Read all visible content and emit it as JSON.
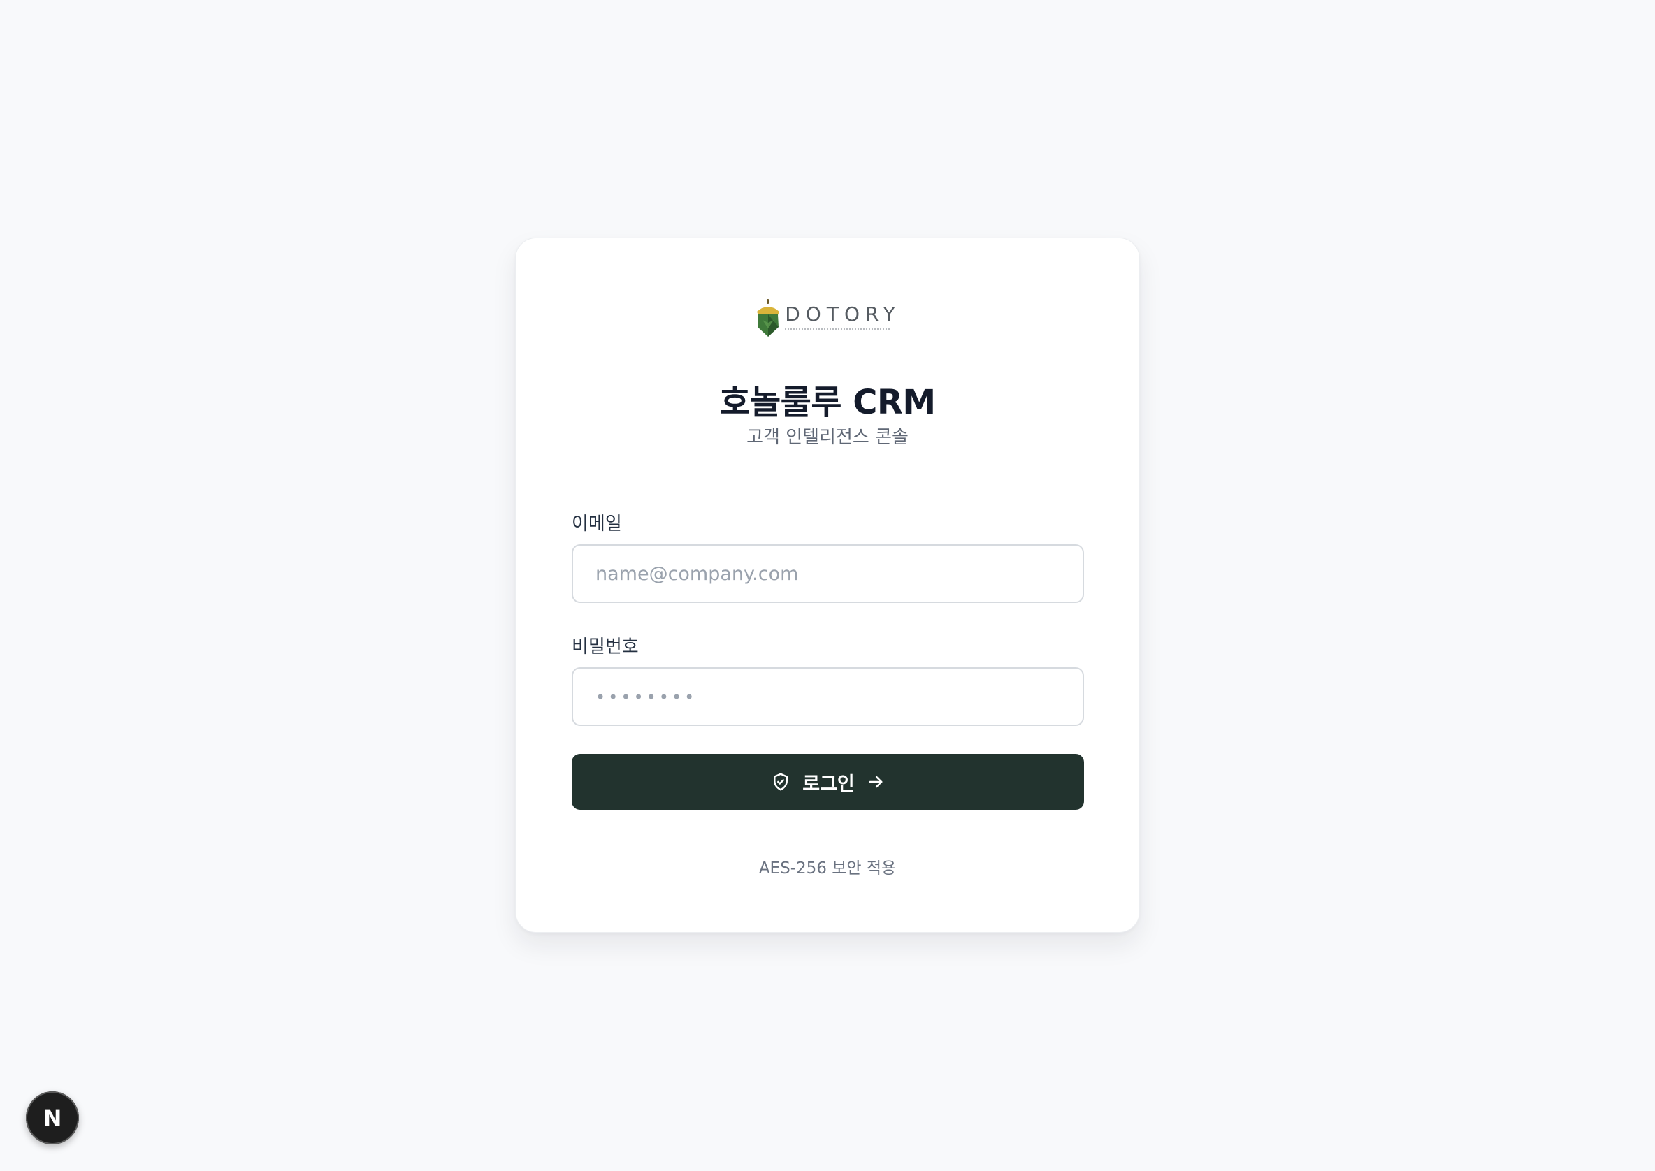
{
  "brand": {
    "logo_word": "DOTORY",
    "colors": {
      "acorn_cap": "#d9b43a",
      "acorn_body": "#3f7a3a",
      "acorn_body_dark": "#2c5a2b"
    }
  },
  "header": {
    "title": "호놀룰루 CRM",
    "subtitle": "고객 인텔리전스 콘솔"
  },
  "form": {
    "email_label": "이메일",
    "email_placeholder": "name@company.com",
    "email_value": "",
    "password_label": "비밀번호",
    "password_placeholder": "••••••••",
    "password_value": "",
    "login_label": "로그인",
    "login_icon": "shield-check-icon",
    "login_trailing_icon": "arrow-right-icon"
  },
  "footer": {
    "security_note": "AES-256 보안 적용"
  },
  "dev_badge": {
    "letter": "N",
    "icon": "nextjs-icon"
  },
  "theme": {
    "page_bg": "#f8f9fb",
    "button_bg": "#22332e",
    "title_color": "#141b2b"
  }
}
